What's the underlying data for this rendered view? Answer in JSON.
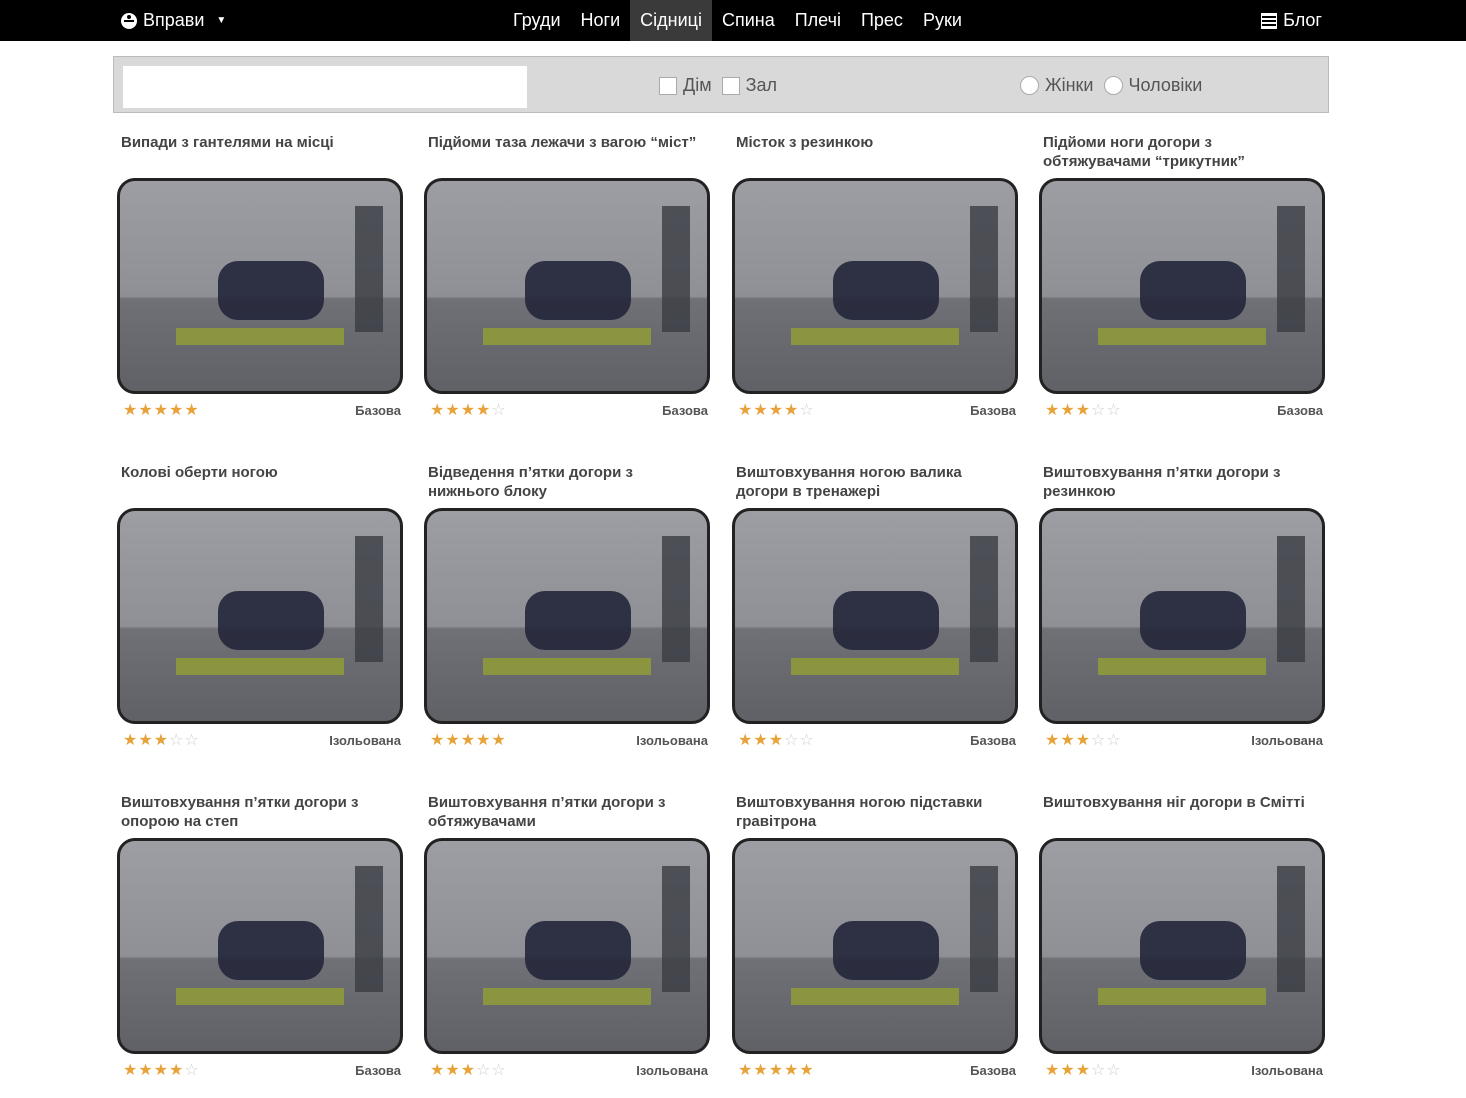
{
  "nav": {
    "menu_label": "Вправи",
    "tabs": [
      "Груди",
      "Ноги",
      "Сідниці",
      "Спина",
      "Плечі",
      "Прес",
      "Руки"
    ],
    "active_tab": "Сідниці",
    "blog_label": "Блог"
  },
  "filters": {
    "search_value": "",
    "checkbox_home": "Дім",
    "checkbox_gym": "Зал",
    "radio_women": "Жінки",
    "radio_men": "Чоловіки"
  },
  "exercises": [
    {
      "title": "Випади з гантелями на місці",
      "rating": 5,
      "type": "Базова"
    },
    {
      "title": "Підйоми таза лежачи з вагою “міст”",
      "rating": 4,
      "type": "Базова"
    },
    {
      "title": "Місток з резинкою",
      "rating": 4,
      "type": "Базова"
    },
    {
      "title": "Підйоми ноги догори з обтяжувачами “трикутник”",
      "rating": 3,
      "type": "Базова"
    },
    {
      "title": "Колові оберти ногою",
      "rating": 3,
      "type": "Ізольована"
    },
    {
      "title": "Відведення п’ятки догори з нижнього блоку",
      "rating": 5,
      "type": "Ізольована"
    },
    {
      "title": "Виштовхування ногою валика догори в тренажері",
      "rating": 3,
      "type": "Базова"
    },
    {
      "title": "Виштовхування п’ятки догори з резинкою",
      "rating": 3,
      "type": "Ізольована"
    },
    {
      "title": "Виштовхування п’ятки догори з опорою на степ",
      "rating": 4,
      "type": "Базова"
    },
    {
      "title": "Виштовхування п’ятки догори з обтяжувачами",
      "rating": 3,
      "type": "Ізольована"
    },
    {
      "title": "Виштовхування ногою підставки гравітрона",
      "rating": 5,
      "type": "Базова"
    },
    {
      "title": "Виштовхування ніг догори в Смітті",
      "rating": 3,
      "type": "Ізольована"
    }
  ],
  "colors": {
    "topbar": "#000000",
    "active_tab": "#3a3a3a",
    "star_full": "#e8a23a",
    "star_empty": "#cfcfcf",
    "filter_bg": "#d9d9d9"
  }
}
